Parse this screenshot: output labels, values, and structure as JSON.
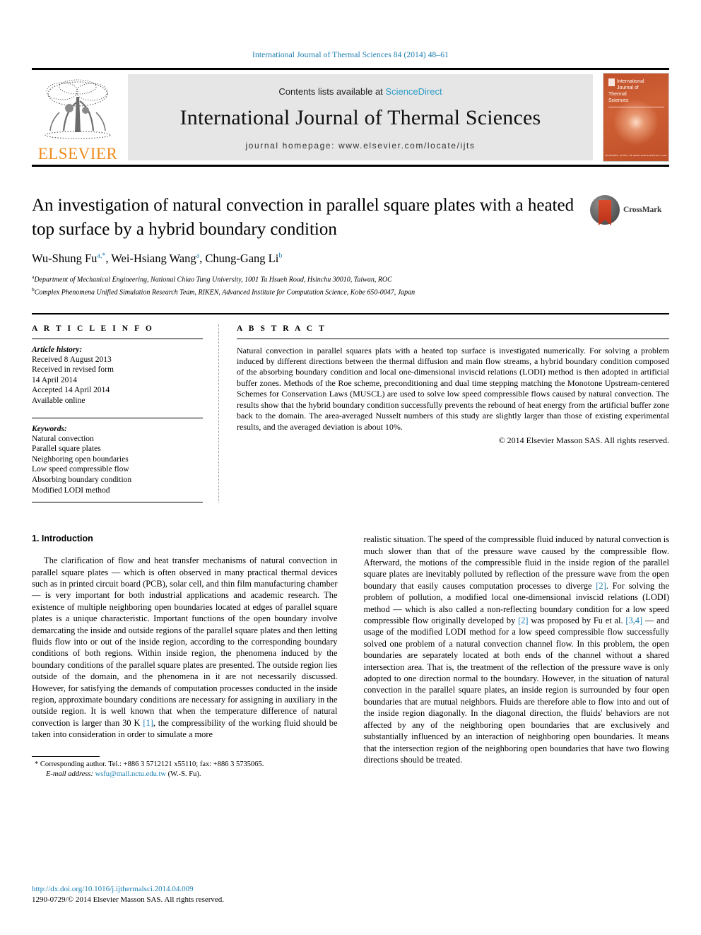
{
  "running_head": "International Journal of Thermal Sciences 84 (2014) 48–61",
  "masthead": {
    "contents_prefix": "Contents lists available at ",
    "sciencedirect": "ScienceDirect",
    "journal_name": "International Journal of Thermal Sciences",
    "homepage": "journal homepage: www.elsevier.com/locate/ijts",
    "publisher": "ELSEVIER",
    "cover_title_lines": [
      "International",
      "Journal of",
      "Thermal",
      "Sciences"
    ],
    "cover_footer": "Available online at www.sciencedirect.com"
  },
  "article": {
    "title": "An investigation of natural convection in parallel square plates with a heated top surface by a hybrid boundary condition",
    "crossmark_label": "CrossMark",
    "authors_html": "Wu-Shung Fu, Wei-Hsiang Wang, Chung-Gang Li",
    "authors": [
      {
        "name": "Wu-Shung Fu",
        "marks": "a,*"
      },
      {
        "name": "Wei-Hsiang Wang",
        "marks": "a"
      },
      {
        "name": "Chung-Gang Li",
        "marks": "b"
      }
    ],
    "affiliations": [
      {
        "mark": "a",
        "text": "Department of Mechanical Engineering, National Chiao Tung University, 1001 Ta Hsueh Road, Hsinchu 30010, Taiwan, ROC"
      },
      {
        "mark": "b",
        "text": "Complex Phenomena Unified Simulation Research Team, RIKEN, Advanced Institute for Computation Science, Kobe 650-0047, Japan"
      }
    ]
  },
  "article_info": {
    "heading": "A R T I C L E   I N F O",
    "history_label": "Article history:",
    "history": [
      "Received 8 August 2013",
      "Received in revised form",
      "14 April 2014",
      "Accepted 14 April 2014",
      "Available online"
    ],
    "keywords_label": "Keywords:",
    "keywords": [
      "Natural convection",
      "Parallel square plates",
      "Neighboring open boundaries",
      "Low speed compressible flow",
      "Absorbing boundary condition",
      "Modified LODI method"
    ]
  },
  "abstract": {
    "heading": "A B S T R A C T",
    "body": "Natural convection in parallel squares plats with a heated top surface is investigated numerically. For solving a problem induced by different directions between the thermal diffusion and main flow streams, a hybrid boundary condition composed of the absorbing boundary condition and local one-dimensional inviscid relations (LODI) method is then adopted in artificial buffer zones. Methods of the Roe scheme, preconditioning and dual time stepping matching the Monotone Upstream-centered Schemes for Conservation Laws (MUSCL) are used to solve low speed compressible flows caused by natural convection. The results show that the hybrid boundary condition successfully prevents the rebound of heat energy from the artificial buffer zone back to the domain. The area-averaged Nusselt numbers of this study are slightly larger than those of existing experimental results, and the averaged deviation is about 10%.",
    "copyright": "© 2014 Elsevier Masson SAS. All rights reserved."
  },
  "introduction": {
    "section_title": "1. Introduction",
    "left_paragraph_part1": "The clarification of flow and heat transfer mechanisms of natural convection in parallel square plates — which is often observed in many practical thermal devices such as in printed circuit board (PCB), solar cell, and thin film manufacturing chamber — is very important for both industrial applications and academic research. The existence of multiple neighboring open boundaries located at edges of parallel square plates is a unique characteristic. Important functions of the open boundary involve demarcating the inside and outside regions of the parallel square plates and then letting fluids flow into or out of the inside region, according to the corresponding boundary conditions of both regions. Within inside region, the phenomena induced by the boundary conditions of the parallel square plates are presented. The outside region lies outside of the domain, and the phenomena in it are not necessarily discussed. However, for satisfying the demands of computation processes conducted in the inside region, approximate boundary conditions are necessary for assigning in auxiliary in the outside region. It is well known that when the temperature difference of natural convection is larger than 30 K ",
    "ref1": "[1]",
    "left_paragraph_part2": ", the compressibility of the working fluid should be taken into consideration in order to simulate a more ",
    "right_paragraph_part1": "realistic situation. The speed of the compressible fluid induced by natural convection is much slower than that of the pressure wave caused by the compressible flow. Afterward, the motions of the compressible fluid in the inside region of the parallel square plates are inevitably polluted by reflection of the pressure wave from the open boundary that easily causes computation processes to diverge ",
    "ref2": "[2]",
    "right_paragraph_part2": ". For solving the problem of pollution, a modified local one-dimensional inviscid relations (LODI) method — which is also called a non-reflecting boundary condition for a low speed compressible flow originally developed by ",
    "ref3": "[2]",
    "right_paragraph_part3": " was proposed by Fu et al. ",
    "ref4": "[3,4]",
    "right_paragraph_part4": " — and usage of the modified LODI method for a low speed compressible flow successfully solved one problem of a natural convection channel flow. In this problem, the open boundaries are separately located at both ends of the channel without a shared intersection area. That is, the treatment of the reflection of the pressure wave is only adopted to one direction normal to the boundary. However, in the situation of natural convection in the parallel square plates, an inside region is surrounded by four open boundaries that are mutual neighbors. Fluids are therefore able to flow into and out of the inside region diagonally. In the diagonal direction, the fluids' behaviors are not affected by any of the neighboring open boundaries that are exclusively and substantially influenced by an interaction of neighboring open boundaries. It means that the intersection region of the neighboring open boundaries that have two flowing directions should be treated."
  },
  "footnote": {
    "corresponding": "* Corresponding author. Tel.: +886 3 5712121 x55110; fax: +886 3 5735065.",
    "email_label": "E-mail address:",
    "email": "wsfu@mail.nctu.edu.tw",
    "email_suffix": "(W.-S. Fu)."
  },
  "page_footer": {
    "doi": "http://dx.doi.org/10.1016/j.ijthermalsci.2014.04.009",
    "issn_line": "1290-0729/© 2014 Elsevier Masson SAS. All rights reserved."
  },
  "colors": {
    "link_blue": "#1a7eb0",
    "sciencedirect_blue": "#2e9cc8",
    "elsevier_orange": "#F08B1D",
    "cover_orange": "#c2512a"
  }
}
